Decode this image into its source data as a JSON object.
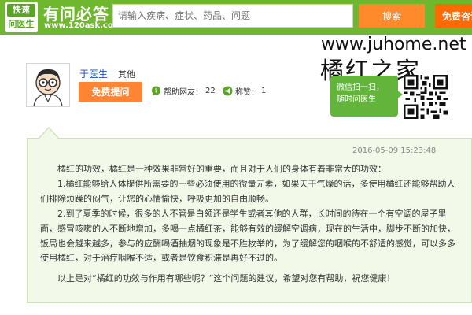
{
  "header": {
    "logo_top": "快速",
    "logo_bottom": "问医生",
    "brand_name": "有问必答",
    "brand_url": "www.120ask.com",
    "search_placeholder": "请输入疾病、症状、药品、问题",
    "search_label": "搜索",
    "consult_label": "免费咨询"
  },
  "watermark": {
    "url": "www.juhome.net",
    "title": "橘红之家"
  },
  "doctor": {
    "name": "于医生",
    "department": "其他",
    "ask_label": "免费提问",
    "helped_label": "帮助网友：",
    "helped_count": "22",
    "praise_label": "称赞：",
    "praise_count": "1"
  },
  "promo": {
    "line1": "微信扫一扫，",
    "line2": "随时问医生"
  },
  "answer": {
    "timestamp": "2016-05-09 15:23:48",
    "paragraphs": [
      "橘红的功效，橘红是一种效果非常好的重要，而且对于人们的身体有着非常大的功效：",
      "1.橘红能够给人体提供所需要的一些必须使用的微量元素，如果天干气燥的话，多使用橘红还能够帮助人们排除烦躁的闷气，让您的心情愉快，呼吸更加的自由顺畅。",
      "2.到了夏季的时候，很多的人不管是白领还是学生或者其他的人群，长时间的待在一个有空调的屋子里面，感冒咳嗽的人不断地增加，多喝一点橘红茶，能够有效的缓解空调病，现在的生活中，脚步不断的加快，饭局也会越来越多，参与的应酬喝酒抽烟的现象是不胜枚举的，为了缓解您的咽喉的不舒适的感觉，可以多多使用橘红，对于治疗咽喉不适，或者是饮食积滞是再好不过的。",
      "以上是对“橘红的功效与作用有哪些呢？”这个问题的建议，希望对您有帮助，祝您健康！"
    ]
  }
}
